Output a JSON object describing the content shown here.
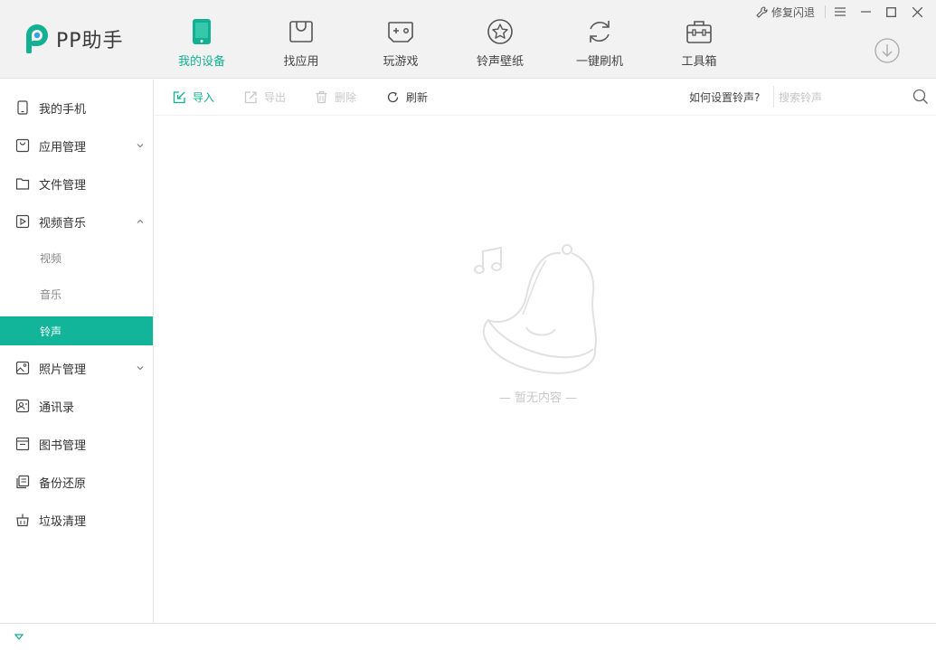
{
  "app": {
    "title": "PP助手"
  },
  "nav": {
    "items": [
      {
        "label": "我的设备",
        "icon": "phone-icon",
        "active": true
      },
      {
        "label": "找应用",
        "icon": "shopping-bag-icon"
      },
      {
        "label": "玩游戏",
        "icon": "gamepad-icon"
      },
      {
        "label": "铃声壁纸",
        "icon": "star-icon"
      },
      {
        "label": "一键刷机",
        "icon": "refresh-icon"
      },
      {
        "label": "工具箱",
        "icon": "toolbox-icon"
      }
    ]
  },
  "window": {
    "repair_label": "修复闪退"
  },
  "sidebar": {
    "items": [
      {
        "label": "我的手机",
        "icon": "phone-icon"
      },
      {
        "label": "应用管理",
        "icon": "app-bag-icon"
      },
      {
        "label": "文件管理",
        "icon": "folder-icon"
      },
      {
        "label": "视频音乐",
        "icon": "play-icon"
      },
      {
        "label": "照片管理",
        "icon": "image-icon"
      },
      {
        "label": "通讯录",
        "icon": "contacts-icon"
      },
      {
        "label": "图书管理",
        "icon": "book-icon"
      },
      {
        "label": "备份还原",
        "icon": "backup-icon"
      },
      {
        "label": "垃圾清理",
        "icon": "trash-clean-icon"
      }
    ],
    "subitems": [
      {
        "label": "视频"
      },
      {
        "label": "音乐"
      },
      {
        "label": "铃声",
        "active": true
      }
    ]
  },
  "toolbar": {
    "import_label": "导入",
    "export_label": "导出",
    "delete_label": "删除",
    "refresh_label": "刷新",
    "help_label": "如何设置铃声?",
    "search_placeholder": "搜索铃声"
  },
  "empty": {
    "text": "— 暂无内容 —"
  },
  "colors": {
    "accent": "#12b193",
    "active_bg": "#12b59a",
    "disabled": "#c8c8c8"
  }
}
